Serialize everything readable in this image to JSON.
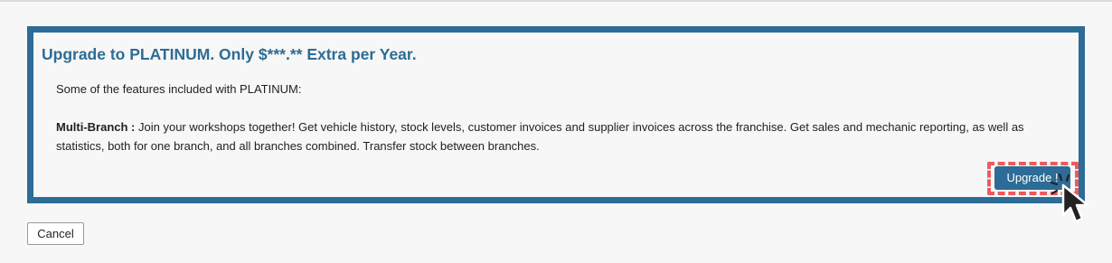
{
  "panel": {
    "title": "Upgrade to PLATINUM. Only $***.** Extra per Year.",
    "intro": "Some of the features included with PLATINUM:",
    "feature": {
      "name": "Multi-Branch :",
      "description": " Join your workshops together! Get vehicle history, stock levels, customer invoices and supplier invoices across the franchise. Get sales and mechanic reporting, as well as statistics, both for one branch, and all branches combined. Transfer stock between branches."
    },
    "upgrade_label": "Upgrade  !"
  },
  "cancel_label": "Cancel",
  "colors": {
    "accent": "#2c6c96",
    "highlight": "#ef5a5a",
    "background": "#f7f7f7"
  },
  "icons": {
    "pointer": "hand-cursor-icon"
  }
}
